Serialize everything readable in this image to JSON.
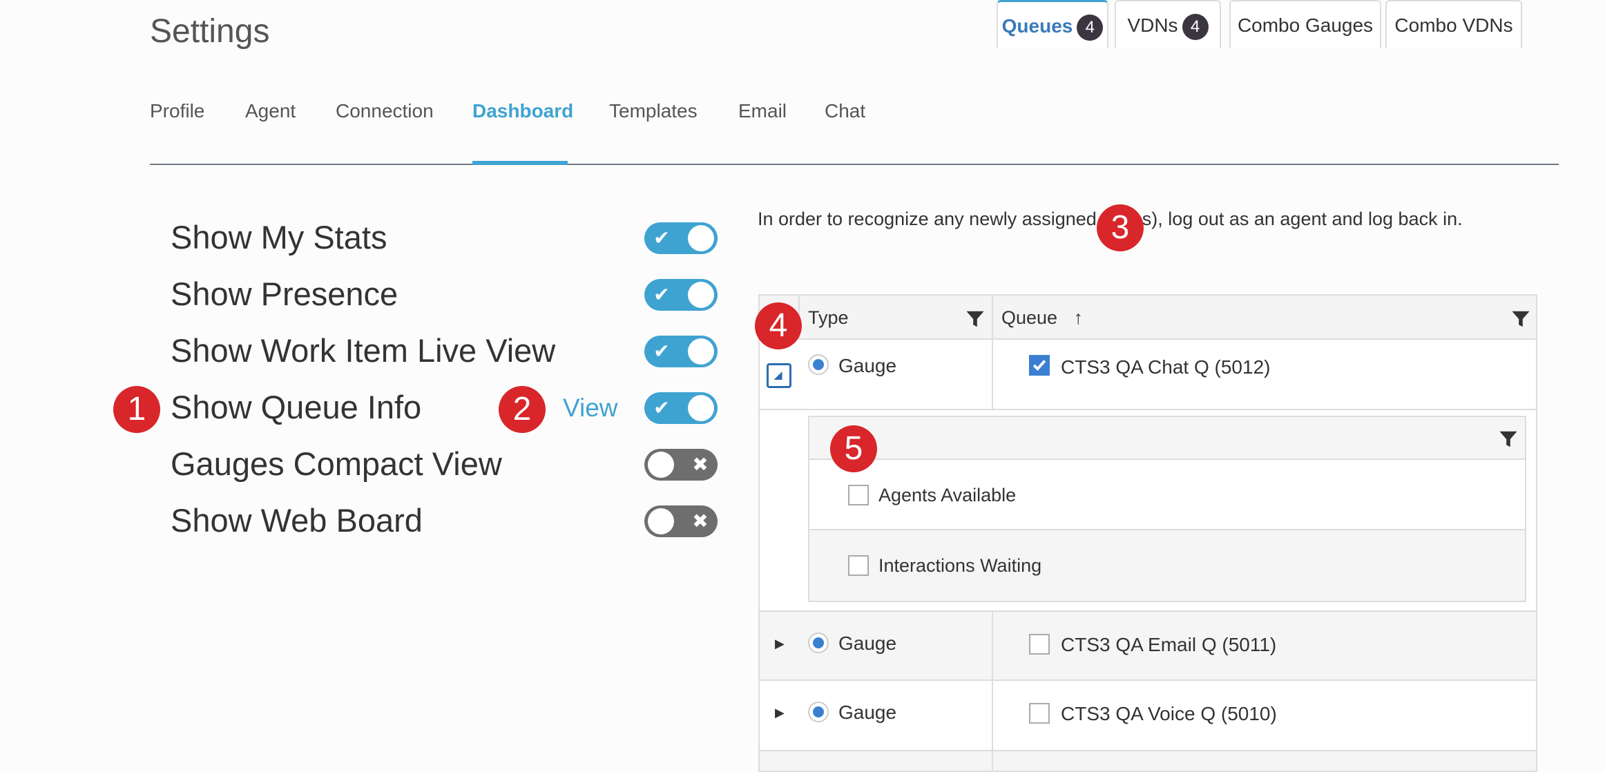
{
  "page": {
    "title": "Settings"
  },
  "nav": {
    "tabs": [
      {
        "label": "Profile"
      },
      {
        "label": "Agent"
      },
      {
        "label": "Connection"
      },
      {
        "label": "Dashboard",
        "active": true
      },
      {
        "label": "Templates"
      },
      {
        "label": "Email"
      },
      {
        "label": "Chat"
      }
    ]
  },
  "settings": [
    {
      "label": "Show My Stats",
      "enabled": true
    },
    {
      "label": "Show Presence",
      "enabled": true
    },
    {
      "label": "Show Work Item Live View",
      "enabled": true
    },
    {
      "label": "Show Queue Info",
      "enabled": true
    },
    {
      "label": "Gauges Compact View",
      "enabled": false
    },
    {
      "label": "Show Web Board",
      "enabled": false
    }
  ],
  "view_link": "View",
  "notice_left": "In order to recognize any newly assigned",
  "notice_right": "s), log out as an agent and log back in.",
  "callouts": [
    "1",
    "2",
    "3",
    "4",
    "5"
  ],
  "subtabs": [
    {
      "label": "Queues",
      "count": "4",
      "active": true
    },
    {
      "label": "VDNs",
      "count": "4"
    },
    {
      "label": "Combo Gauges"
    },
    {
      "label": "Combo VDNs"
    }
  ],
  "grid": {
    "columns": {
      "type": "Type",
      "queue": "Queue",
      "sort_arrow": "↑"
    },
    "rows": [
      {
        "type": "Gauge",
        "queue": "CTS3 QA Chat Q (5012)",
        "checked": true,
        "expanded": true
      },
      {
        "type": "Gauge",
        "queue": "CTS3 QA Email Q (5011)",
        "checked": false,
        "expanded": false
      },
      {
        "type": "Gauge",
        "queue": "CTS3 QA Voice Q (5010)",
        "checked": false,
        "expanded": false
      }
    ],
    "detail_items": [
      {
        "label": "Agents Available",
        "checked": false
      },
      {
        "label": "Interactions Waiting",
        "checked": false
      }
    ]
  },
  "colors": {
    "accent": "#3fa3d2",
    "callout": "#d8262a",
    "toggle_off": "#6e6e6e"
  }
}
